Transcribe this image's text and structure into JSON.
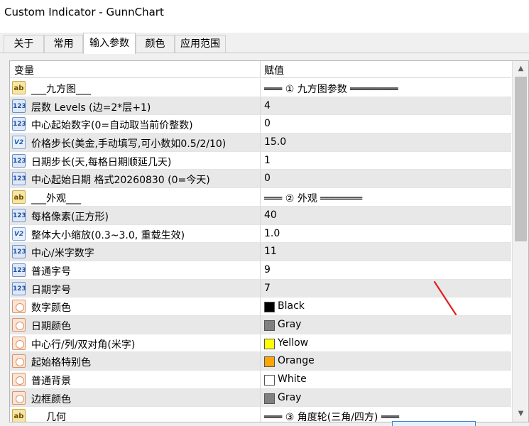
{
  "window": {
    "title": "Custom Indicator - GunnChart"
  },
  "tabs": [
    {
      "label": "关于",
      "active": false
    },
    {
      "label": "常用",
      "active": false
    },
    {
      "label": "输入参数",
      "active": true
    },
    {
      "label": "颜色",
      "active": false
    },
    {
      "label": "应用范围",
      "active": false
    }
  ],
  "grid": {
    "header": {
      "variable": "变量",
      "value": "赋值"
    },
    "rows": [
      {
        "icon": "ab",
        "name": "___九方图___",
        "value": "═══ ① 九方图参数 ════════"
      },
      {
        "icon": "123",
        "name": "层数 Levels  (边=2*层+1)",
        "value": "4"
      },
      {
        "icon": "123",
        "name": "中心起始数字(0=自动取当前价整数)",
        "value": "0"
      },
      {
        "icon": "v2",
        "name": "价格步长(美金,手动填写,可小数如0.5/2/10)",
        "value": "15.0"
      },
      {
        "icon": "123",
        "name": "日期步长(天,每格日期顺延几天)",
        "value": "1"
      },
      {
        "icon": "123",
        "name": "中心起始日期 格式20260830 (0=今天)",
        "value": "0"
      },
      {
        "icon": "ab",
        "name": "___外观___",
        "value": "═══ ② 外观 ═══════"
      },
      {
        "icon": "123",
        "name": "每格像素(正方形)",
        "value": "40"
      },
      {
        "icon": "v2",
        "name": "整体大小缩放(0.3~3.0, 重载生效)",
        "value": "1.0"
      },
      {
        "icon": "123",
        "name": "中心/米字数字",
        "value": "11"
      },
      {
        "icon": "123",
        "name": "普通字号",
        "value": "9"
      },
      {
        "icon": "123",
        "name": "日期字号",
        "value": "7"
      },
      {
        "icon": "color",
        "name": "数字颜色",
        "value": "Black",
        "swatch": "#000000"
      },
      {
        "icon": "color",
        "name": "日期颜色",
        "value": "Gray",
        "swatch": "#808080"
      },
      {
        "icon": "color",
        "name": "中心行/列/双对角(米字)",
        "value": "Yellow",
        "swatch": "#ffff00"
      },
      {
        "icon": "color",
        "name": "起始格特别色",
        "value": "Orange",
        "swatch": "#ffa500"
      },
      {
        "icon": "color",
        "name": "普通背景",
        "value": "White",
        "swatch": "#ffffff"
      },
      {
        "icon": "color",
        "name": "边框颜色",
        "value": "Gray",
        "swatch": "#808080"
      },
      {
        "icon": "ab",
        "name": "___几何___",
        "value": "═══ ③ 角度轮(三角/四方) ═══"
      }
    ]
  },
  "colors": {
    "annotation_stroke": "#e02020",
    "scroll_thumb": "#c1c1c1"
  }
}
